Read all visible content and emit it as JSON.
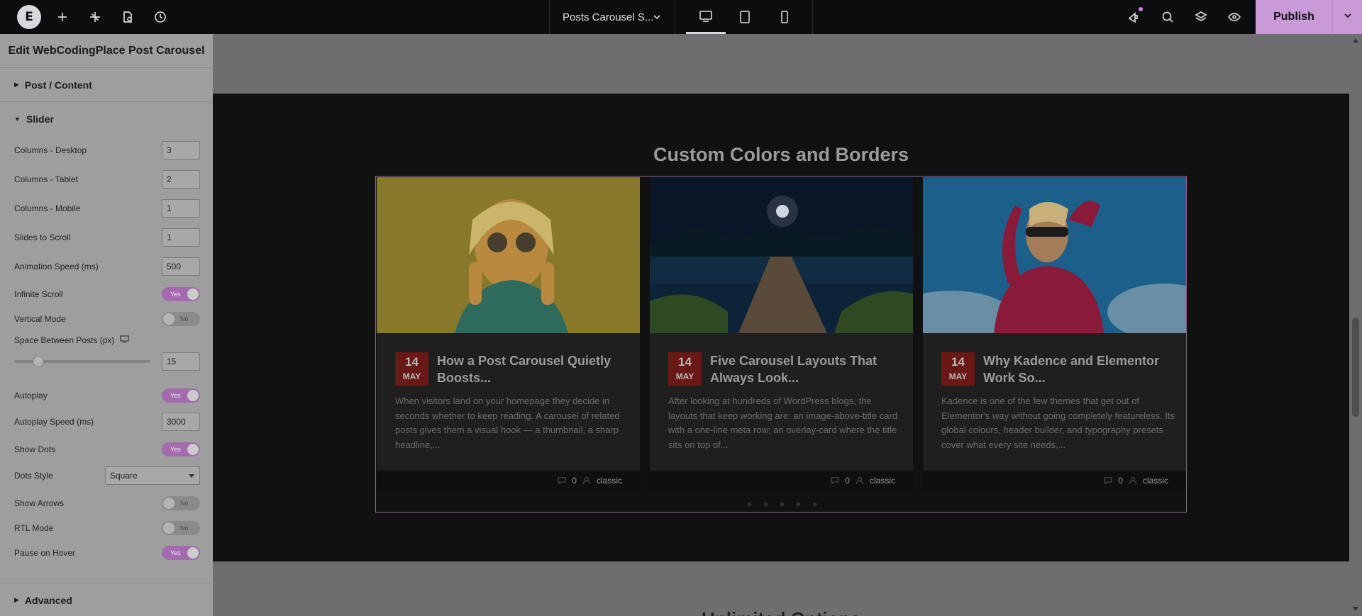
{
  "topbar": {
    "logo_text": "E",
    "document_name": "Posts Carousel S...",
    "publish_label": "Publish",
    "icons": [
      "add-icon",
      "ai-sparkle-icon",
      "page-settings-icon",
      "history-icon",
      "notifications-icon",
      "search-icon",
      "layers-icon",
      "preview-icon"
    ],
    "devices": [
      "desktop",
      "tablet",
      "mobile"
    ],
    "active_device": "desktop"
  },
  "panel": {
    "title": "Edit WebCodingPlace Post Carousel",
    "sections": {
      "content": "Post / Content",
      "slider": "Slider",
      "advanced": "Advanced"
    },
    "controls": {
      "columns_desktop": {
        "label": "Columns - Desktop",
        "value": "3"
      },
      "columns_tablet": {
        "label": "Columns - Tablet",
        "value": "2"
      },
      "columns_mobile": {
        "label": "Columns - Mobile",
        "value": "1"
      },
      "slides_to_scroll": {
        "label": "Slides to Scroll",
        "value": "1"
      },
      "animation_speed": {
        "label": "Animation Speed (ms)",
        "value": "500"
      },
      "infinite_scroll": {
        "label": "Infinite Scroll",
        "value": "Yes"
      },
      "vertical_mode": {
        "label": "Vertical Mode",
        "value": "No"
      },
      "space_between": {
        "label": "Space Between Posts (px)",
        "value": "15",
        "fraction": 0.15
      },
      "autoplay": {
        "label": "Autoplay",
        "value": "Yes"
      },
      "autoplay_speed": {
        "label": "Autoplay Speed (ms)",
        "value": "3000"
      },
      "show_dots": {
        "label": "Show Dots",
        "value": "Yes"
      },
      "dots_style": {
        "label": "Dots Style",
        "value": "Square"
      },
      "show_arrows": {
        "label": "Show Arrows",
        "value": "No"
      },
      "rtl_mode": {
        "label": "RTL Mode",
        "value": "No"
      },
      "pause_on_hover": {
        "label": "Pause on Hover",
        "value": "Yes"
      }
    }
  },
  "canvas": {
    "section_heading": "Custom Colors and Borders",
    "bottom_heading": "Unlimited Options",
    "posts": [
      {
        "day": "14",
        "month": "MAY",
        "title": "How a Post Carousel Quietly Boosts...",
        "excerpt": "When visitors land on your homepage they decide in seconds whether to keep reading. A carousel of related posts gives them a visual hook — a thumbnail, a sharp headline,...",
        "comments": "0",
        "author": "classic",
        "image": "woman-sunglasses-yellow-wall"
      },
      {
        "day": "14",
        "month": "MAY",
        "title": "Five Carousel Layouts That Always Look...",
        "excerpt": "After looking at hundreds of WordPress blogs, the layouts that keep working are: an image-above-title card with a one-line meta row; an overlay-card where the title sits on top of...",
        "comments": "0",
        "author": "classic",
        "image": "night-lake-pier-moon"
      },
      {
        "day": "14",
        "month": "MAY",
        "title": "Why Kadence and Elementor Work So...",
        "excerpt": "Kadence is one of the few themes that get out of Elementor's way without going completely featureless. Its global colours, header builder, and typography presets cover what every site needs,...",
        "comments": "0",
        "author": "classic",
        "image": "woman-pink-shirt-blue-sky"
      }
    ],
    "dots_count": 5
  },
  "colors": {
    "accent": "#c99ad6",
    "toggle_on": "#a36aae",
    "date_box": "#6a1815"
  }
}
